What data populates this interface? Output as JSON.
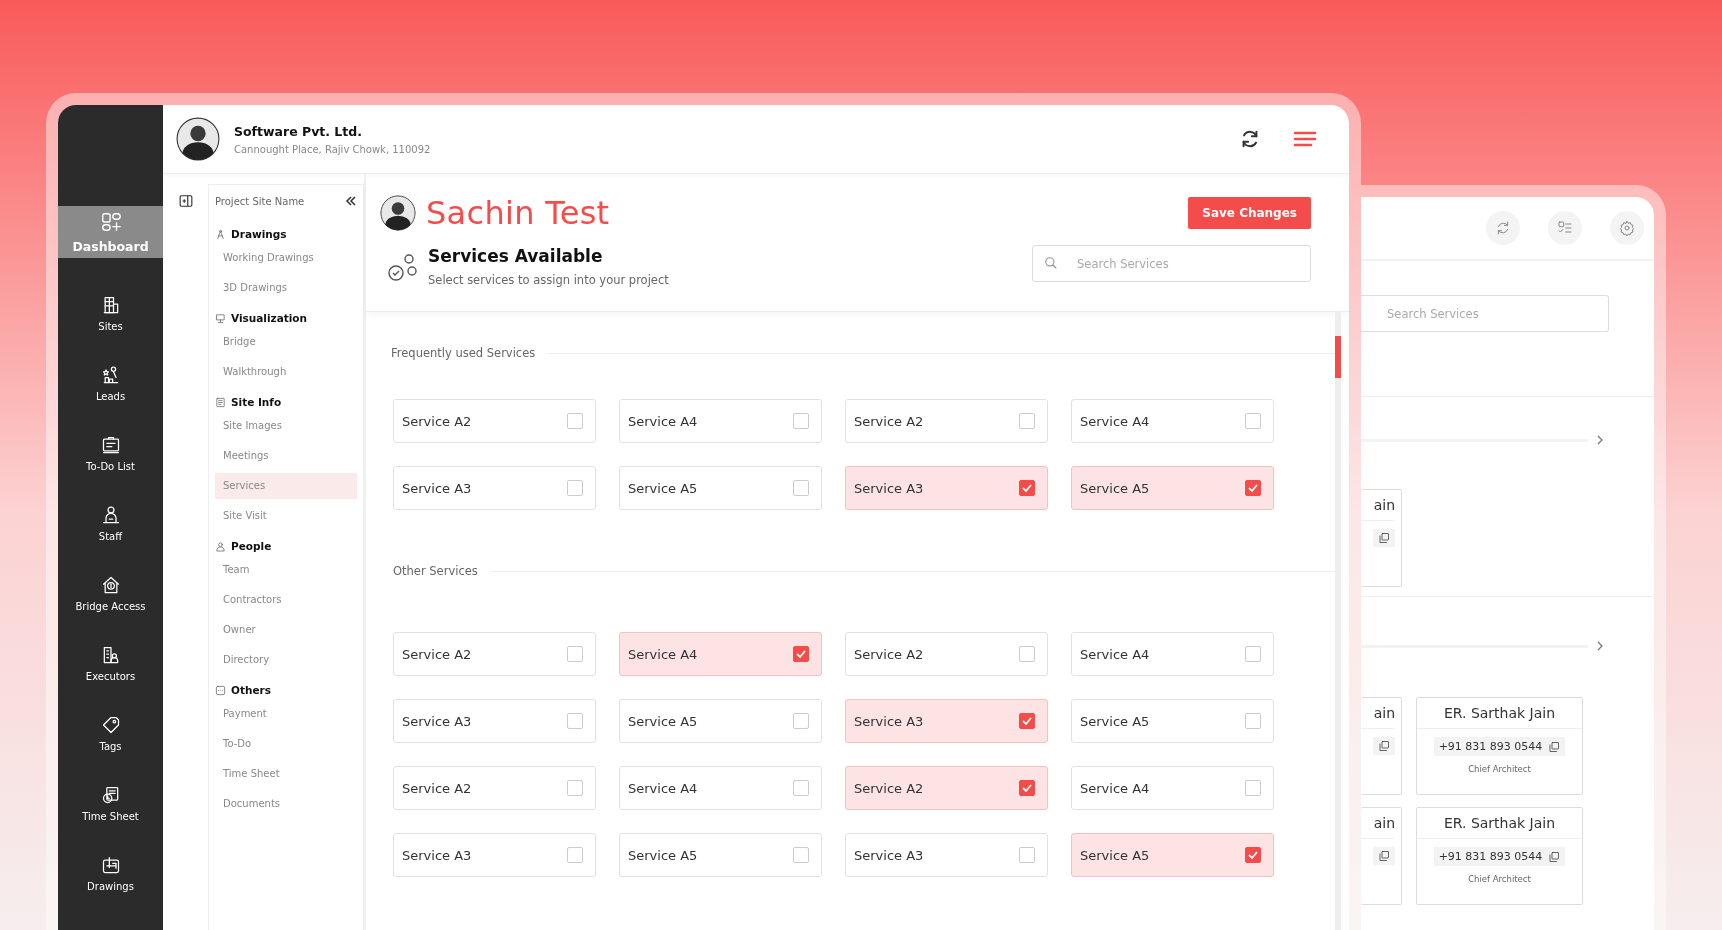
{
  "company": {
    "name": "Software Pvt. Ltd.",
    "address": "Cannought Place, Rajiv Chowk, 110092"
  },
  "main_nav": [
    {
      "label": "Dashboard",
      "selected": true
    },
    {
      "label": "Sites",
      "selected": false
    },
    {
      "label": "Leads",
      "selected": false
    },
    {
      "label": "To-Do List",
      "selected": false
    },
    {
      "label": "Staff",
      "selected": false
    },
    {
      "label": "Bridge Access",
      "selected": false
    },
    {
      "label": "Executors",
      "selected": false
    },
    {
      "label": "Tags",
      "selected": false
    },
    {
      "label": "Time Sheet",
      "selected": false
    },
    {
      "label": "Drawings",
      "selected": false
    }
  ],
  "site_nav": {
    "title": "Project Site Name",
    "groups": [
      {
        "label": "Drawings",
        "items": [
          {
            "label": "Working Drawings",
            "selected": false
          },
          {
            "label": "3D Drawings",
            "selected": false
          }
        ]
      },
      {
        "label": "Visualization",
        "items": [
          {
            "label": "Bridge",
            "selected": false
          },
          {
            "label": "Walkthrough",
            "selected": false
          }
        ]
      },
      {
        "label": "Site Info",
        "items": [
          {
            "label": "Site Images",
            "selected": false
          },
          {
            "label": "Meetings",
            "selected": false
          },
          {
            "label": "Services",
            "selected": true
          },
          {
            "label": "Site Visit",
            "selected": false
          }
        ]
      },
      {
        "label": "People",
        "items": [
          {
            "label": "Team",
            "selected": false
          },
          {
            "label": "Contractors",
            "selected": false
          },
          {
            "label": "Owner",
            "selected": false
          },
          {
            "label": "Directory",
            "selected": false
          }
        ]
      },
      {
        "label": "Others",
        "items": [
          {
            "label": "Payment",
            "selected": false
          },
          {
            "label": "To-Do",
            "selected": false
          },
          {
            "label": "Time Sheet",
            "selected": false
          },
          {
            "label": "Documents",
            "selected": false
          }
        ]
      }
    ]
  },
  "project": {
    "name": "Sachin Test"
  },
  "save_button": "Save Changes",
  "services_header": {
    "title": "Services Available",
    "subtitle": "Select services to assign into your project"
  },
  "search": {
    "placeholder": "Search Services"
  },
  "sections": [
    {
      "title": "Frequently used Services",
      "services": [
        {
          "label": "Service A2",
          "checked": false
        },
        {
          "label": "Service A4",
          "checked": false
        },
        {
          "label": "Service A2",
          "checked": false
        },
        {
          "label": "Service A4",
          "checked": false
        },
        {
          "label": "Service A3",
          "checked": false
        },
        {
          "label": "Service A5",
          "checked": false
        },
        {
          "label": "Service A3",
          "checked": true
        },
        {
          "label": "Service A5",
          "checked": true
        }
      ]
    },
    {
      "title": "Other Services",
      "services": [
        {
          "label": "Service A2",
          "checked": false
        },
        {
          "label": "Service A4",
          "checked": true
        },
        {
          "label": "Service A2",
          "checked": false
        },
        {
          "label": "Service A4",
          "checked": false
        },
        {
          "label": "Service A3",
          "checked": false
        },
        {
          "label": "Service A5",
          "checked": false
        },
        {
          "label": "Service A3",
          "checked": true
        },
        {
          "label": "Service A5",
          "checked": false
        },
        {
          "label": "Service A2",
          "checked": false
        },
        {
          "label": "Service A4",
          "checked": false
        },
        {
          "label": "Service A2",
          "checked": true
        },
        {
          "label": "Service A4",
          "checked": false
        },
        {
          "label": "Service A3",
          "checked": false
        },
        {
          "label": "Service A5",
          "checked": false
        },
        {
          "label": "Service A3",
          "checked": false
        },
        {
          "label": "Service A5",
          "checked": true
        }
      ]
    }
  ],
  "back_window": {
    "search": {
      "placeholder": "Search Services"
    },
    "sections": [
      {
        "rows": [
          [
            {
              "kind": "partial",
              "name": "ain"
            }
          ]
        ]
      },
      {
        "rows": [
          [
            {
              "kind": "partial",
              "name": "ain"
            },
            {
              "kind": "full",
              "name": "ER. Sarthak Jain",
              "phone": "+91 831 893 0544",
              "role": "Chief Architect"
            }
          ],
          [
            {
              "kind": "partial",
              "name": "ain"
            },
            {
              "kind": "full",
              "name": "ER. Sarthak Jain",
              "phone": "+91 831 893 0544",
              "role": "Chief Architect"
            }
          ]
        ]
      }
    ]
  }
}
